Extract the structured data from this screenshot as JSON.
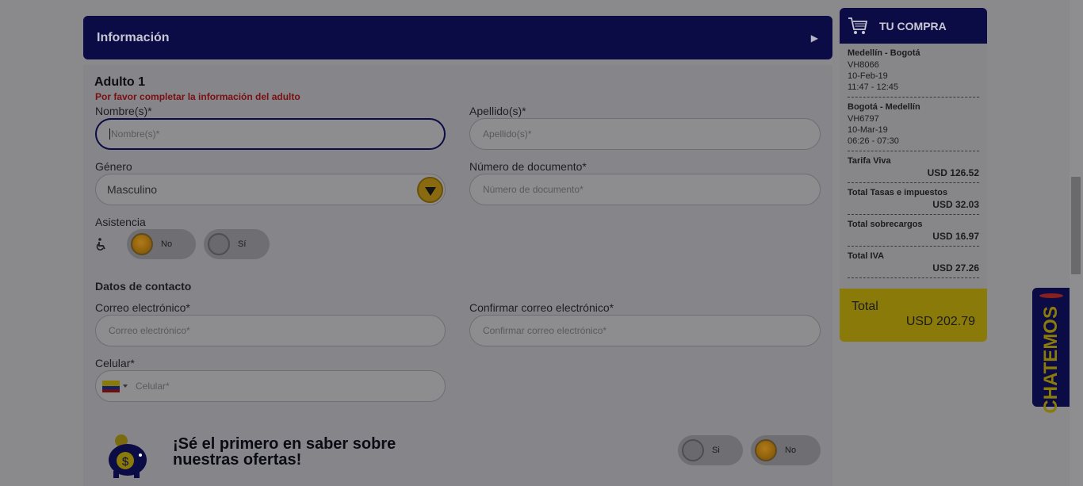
{
  "info_header": {
    "title": "Información",
    "arrow": "▶"
  },
  "adult": {
    "heading": "Adulto 1",
    "warning": "Por favor completar la información del adulto",
    "first_name": {
      "label": "Nombre(s)*",
      "placeholder": "Nombre(s)*"
    },
    "last_name": {
      "label": "Apellido(s)*",
      "placeholder": "Apellido(s)*"
    },
    "gender": {
      "label": "Género",
      "value": "Masculino"
    },
    "document": {
      "label": "Número de documento*",
      "placeholder": "Número de documento*"
    },
    "assistance": {
      "label": "Asistencia",
      "icon": "wheelchair-icon",
      "options": [
        "No",
        "Sí"
      ],
      "selected": "No"
    }
  },
  "contact": {
    "heading": "Datos de contacto",
    "email": {
      "label": "Correo electrónico*",
      "placeholder": "Correo electrónico*"
    },
    "confirm_email": {
      "label": "Confirmar correo electrónico*",
      "placeholder": "Confirmar correo electrónico*"
    },
    "mobile": {
      "label": "Celular*",
      "placeholder": "Celular*",
      "flag": "colombia-flag-icon"
    }
  },
  "promo": {
    "line1": "¡Sé el primero en saber sobre",
    "line2": "nuestras ofertas!",
    "icon": "piggy-bank-icon",
    "options": [
      "Si",
      "No"
    ],
    "selected": "No"
  },
  "summary": {
    "title": "TU COMPRA",
    "icon": "cart-icon",
    "flights": [
      {
        "route": "Medellín - Bogotá",
        "code": "VH8066",
        "date": "10-Feb-19",
        "time": "11:47 - 12:45"
      },
      {
        "route": "Bogotá - Medellín",
        "code": "VH6797",
        "date": "10-Mar-19",
        "time": "06:26 - 07:30"
      }
    ],
    "charges": [
      {
        "name": "Tarifa Viva",
        "amount": "USD 126.52"
      },
      {
        "name": "Total Tasas e impuestos",
        "amount": "USD 32.03"
      },
      {
        "name": "Total sobrecargos",
        "amount": "USD 16.97"
      },
      {
        "name": "Total IVA",
        "amount": "USD 27.26"
      }
    ],
    "total_label": "Total",
    "total_value": "USD 202.79"
  },
  "chat": {
    "label": "CHATEMOS",
    "icon": "chat-bubble-icon"
  },
  "colors": {
    "navy": "#0b0b45",
    "yellow": "#8a7a0a",
    "overlay": "#8a8a8d"
  }
}
